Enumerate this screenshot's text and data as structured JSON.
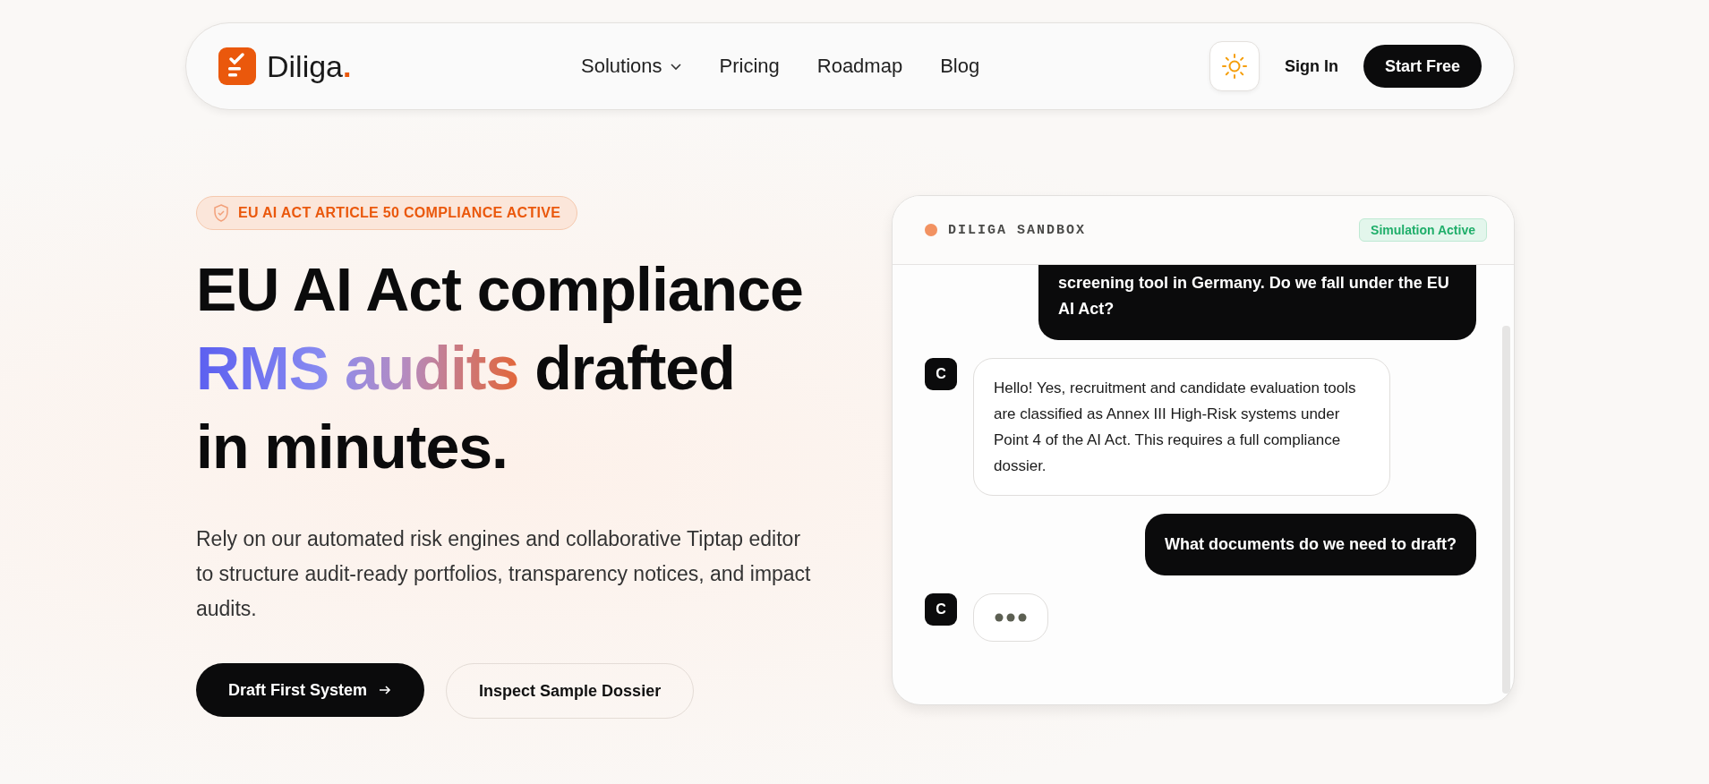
{
  "nav": {
    "brand": "Diliga",
    "brand_mark": ".",
    "links": [
      {
        "label": "Solutions",
        "kind": "dropdown"
      },
      {
        "label": "Pricing",
        "kind": "link"
      },
      {
        "label": "Roadmap",
        "kind": "link"
      },
      {
        "label": "Blog",
        "kind": "link"
      }
    ],
    "sign_in": "Sign In",
    "start": "Start Free"
  },
  "hero": {
    "badge": "EU AI ACT ARTICLE 50 COMPLIANCE ACTIVE",
    "headline": [
      [
        {
          "text": "EU AI Act compliance",
          "kind": "plain"
        }
      ],
      [
        {
          "text": "RMS audits",
          "kind": "gradient"
        },
        {
          "text": "drafted",
          "kind": "plain"
        }
      ],
      [
        {
          "text": "in minutes.",
          "kind": "plain"
        }
      ]
    ],
    "description": "Rely on our automated risk engines and collaborative Tiptap editor to structure audit-ready portfolios, transparency notices, and impact audits.",
    "buttons": [
      {
        "label": "Draft First System",
        "kind": "primary"
      },
      {
        "label": "Inspect Sample Dossier",
        "kind": "secondary"
      }
    ]
  },
  "chat": {
    "title": "DILIGA SANDBOX",
    "status": "Simulation Active",
    "messages": [
      {
        "kind": "user",
        "text": "screening tool in Germany. Do we fall under the EU AI Act?"
      },
      {
        "kind": "assistant",
        "avatar": "C",
        "text": "Hello! Yes, recruitment and candidate evaluation tools are classified as Annex III High-Risk systems under Point 4 of the AI Act. This requires a full compliance dossier."
      },
      {
        "kind": "user",
        "text": "What documents do we need to draft?"
      },
      {
        "kind": "typing",
        "avatar": "C"
      }
    ]
  }
}
